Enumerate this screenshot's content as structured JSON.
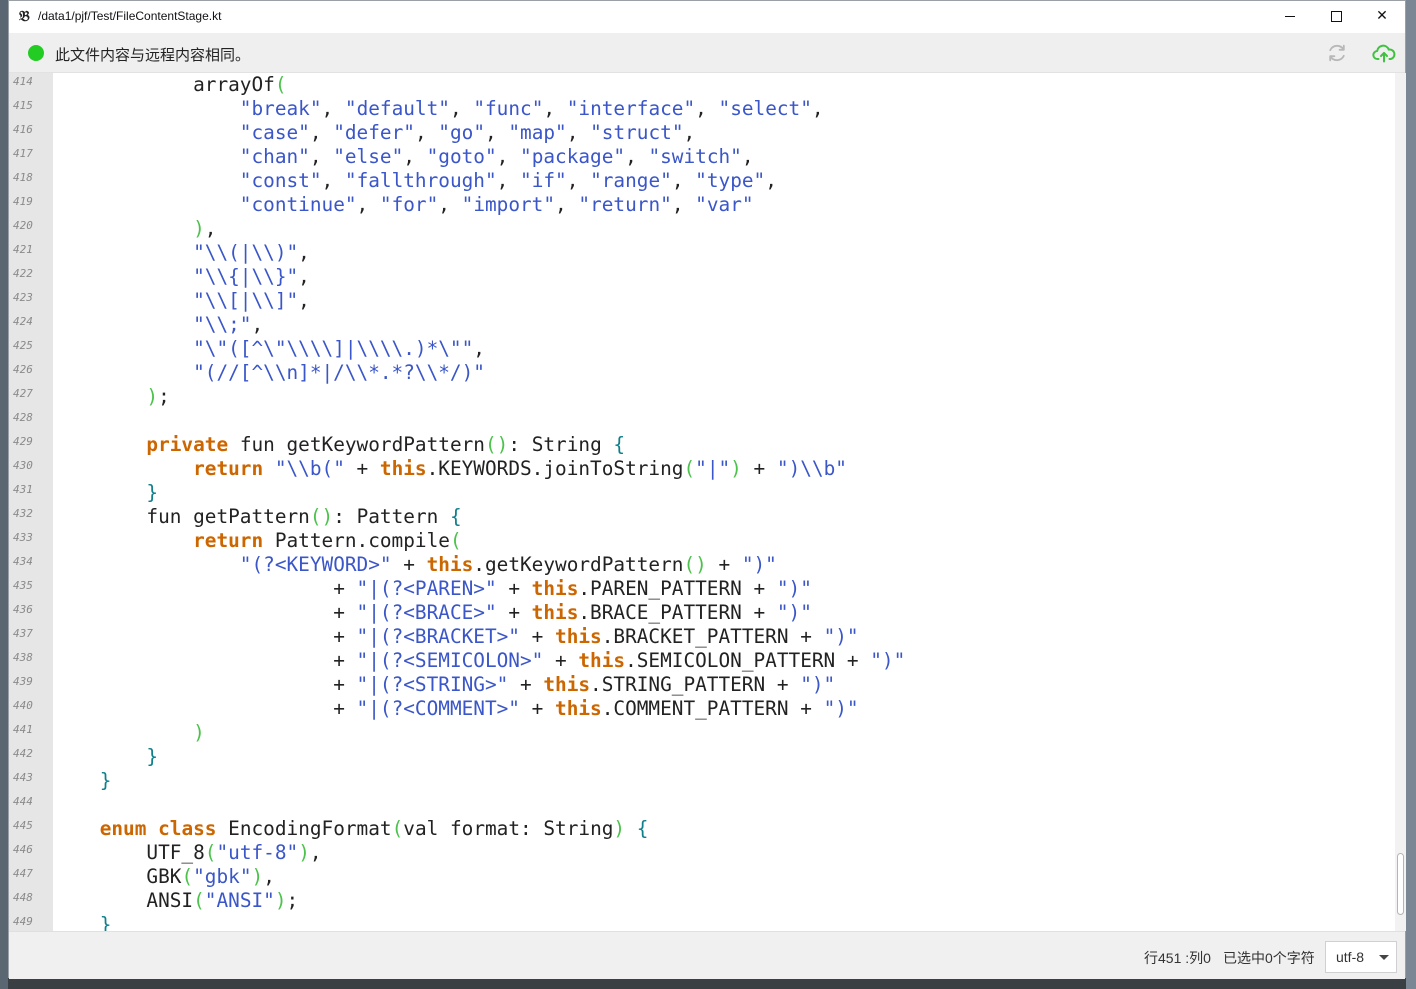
{
  "window": {
    "title": "/data1/pjf/Test/FileContentStage.kt",
    "app_icon": "𝔅",
    "close_glyph": "✕"
  },
  "infobar": {
    "status_color": "#22cc22",
    "message": "此文件内容与远程内容相同。",
    "icons": [
      "refresh-icon",
      "cloud-upload-icon"
    ]
  },
  "editor": {
    "lines": [
      {
        "n": "414",
        "tokens": [
          [
            "            ",
            "plain"
          ],
          [
            "arrayOf",
            "plain"
          ],
          [
            "(",
            "paren"
          ]
        ]
      },
      {
        "n": "415",
        "tokens": [
          [
            "                ",
            "plain"
          ],
          [
            "\"break\"",
            "str"
          ],
          [
            ", ",
            "op"
          ],
          [
            "\"default\"",
            "str"
          ],
          [
            ", ",
            "op"
          ],
          [
            "\"func\"",
            "str"
          ],
          [
            ", ",
            "op"
          ],
          [
            "\"interface\"",
            "str"
          ],
          [
            ", ",
            "op"
          ],
          [
            "\"select\"",
            "str"
          ],
          [
            ",",
            "op"
          ]
        ]
      },
      {
        "n": "416",
        "tokens": [
          [
            "                ",
            "plain"
          ],
          [
            "\"case\"",
            "str"
          ],
          [
            ", ",
            "op"
          ],
          [
            "\"defer\"",
            "str"
          ],
          [
            ", ",
            "op"
          ],
          [
            "\"go\"",
            "str"
          ],
          [
            ", ",
            "op"
          ],
          [
            "\"map\"",
            "str"
          ],
          [
            ", ",
            "op"
          ],
          [
            "\"struct\"",
            "str"
          ],
          [
            ",",
            "op"
          ]
        ]
      },
      {
        "n": "417",
        "tokens": [
          [
            "                ",
            "plain"
          ],
          [
            "\"chan\"",
            "str"
          ],
          [
            ", ",
            "op"
          ],
          [
            "\"else\"",
            "str"
          ],
          [
            ", ",
            "op"
          ],
          [
            "\"goto\"",
            "str"
          ],
          [
            ", ",
            "op"
          ],
          [
            "\"package\"",
            "str"
          ],
          [
            ", ",
            "op"
          ],
          [
            "\"switch\"",
            "str"
          ],
          [
            ",",
            "op"
          ]
        ]
      },
      {
        "n": "418",
        "tokens": [
          [
            "                ",
            "plain"
          ],
          [
            "\"const\"",
            "str"
          ],
          [
            ", ",
            "op"
          ],
          [
            "\"fallthrough\"",
            "str"
          ],
          [
            ", ",
            "op"
          ],
          [
            "\"if\"",
            "str"
          ],
          [
            ", ",
            "op"
          ],
          [
            "\"range\"",
            "str"
          ],
          [
            ", ",
            "op"
          ],
          [
            "\"type\"",
            "str"
          ],
          [
            ",",
            "op"
          ]
        ]
      },
      {
        "n": "419",
        "tokens": [
          [
            "                ",
            "plain"
          ],
          [
            "\"continue\"",
            "str"
          ],
          [
            ", ",
            "op"
          ],
          [
            "\"for\"",
            "str"
          ],
          [
            ", ",
            "op"
          ],
          [
            "\"import\"",
            "str"
          ],
          [
            ", ",
            "op"
          ],
          [
            "\"return\"",
            "str"
          ],
          [
            ", ",
            "op"
          ],
          [
            "\"var\"",
            "str"
          ]
        ]
      },
      {
        "n": "420",
        "tokens": [
          [
            "            ",
            "plain"
          ],
          [
            ")",
            "paren"
          ],
          [
            ",",
            "op"
          ]
        ]
      },
      {
        "n": "421",
        "tokens": [
          [
            "            ",
            "plain"
          ],
          [
            "\"\\\\(|\\\\)\"",
            "str"
          ],
          [
            ",",
            "op"
          ]
        ]
      },
      {
        "n": "422",
        "tokens": [
          [
            "            ",
            "plain"
          ],
          [
            "\"\\\\{|\\\\}\"",
            "str"
          ],
          [
            ",",
            "op"
          ]
        ]
      },
      {
        "n": "423",
        "tokens": [
          [
            "            ",
            "plain"
          ],
          [
            "\"\\\\[|\\\\]\"",
            "str"
          ],
          [
            ",",
            "op"
          ]
        ]
      },
      {
        "n": "424",
        "tokens": [
          [
            "            ",
            "plain"
          ],
          [
            "\"\\\\;\"",
            "str"
          ],
          [
            ",",
            "op"
          ]
        ]
      },
      {
        "n": "425",
        "tokens": [
          [
            "            ",
            "plain"
          ],
          [
            "\"\\\"([^\\\"\\\\\\\\]|\\\\\\\\.)*\\\"\"",
            "str"
          ],
          [
            ",",
            "op"
          ]
        ]
      },
      {
        "n": "426",
        "tokens": [
          [
            "            ",
            "plain"
          ],
          [
            "\"(//[^\\\\n]*|/\\\\*.*?\\\\*/)\"",
            "str"
          ]
        ]
      },
      {
        "n": "427",
        "tokens": [
          [
            "        ",
            "plain"
          ],
          [
            ")",
            "paren"
          ],
          [
            ";",
            "op"
          ]
        ]
      },
      {
        "n": "428",
        "tokens": []
      },
      {
        "n": "429",
        "tokens": [
          [
            "        ",
            "plain"
          ],
          [
            "private",
            "kw"
          ],
          [
            " fun getKeywordPattern",
            "plain"
          ],
          [
            "()",
            "paren"
          ],
          [
            ": String ",
            "plain"
          ],
          [
            "{",
            "brace"
          ]
        ]
      },
      {
        "n": "430",
        "tokens": [
          [
            "            ",
            "plain"
          ],
          [
            "return",
            "kw"
          ],
          [
            " ",
            "plain"
          ],
          [
            "\"\\\\b(\"",
            "str"
          ],
          [
            " + ",
            "op"
          ],
          [
            "this",
            "kw"
          ],
          [
            ".KEYWORDS.joinToString",
            "plain"
          ],
          [
            "(",
            "paren"
          ],
          [
            "\"|\"",
            "str"
          ],
          [
            ")",
            "paren"
          ],
          [
            " + ",
            "op"
          ],
          [
            "\")\\\\b\"",
            "str"
          ]
        ]
      },
      {
        "n": "431",
        "tokens": [
          [
            "        ",
            "plain"
          ],
          [
            "}",
            "brace"
          ]
        ]
      },
      {
        "n": "432",
        "tokens": [
          [
            "        ",
            "plain"
          ],
          [
            "fun getPattern",
            "plain"
          ],
          [
            "()",
            "paren"
          ],
          [
            ": Pattern ",
            "plain"
          ],
          [
            "{",
            "brace"
          ]
        ]
      },
      {
        "n": "433",
        "tokens": [
          [
            "            ",
            "plain"
          ],
          [
            "return",
            "kw"
          ],
          [
            " Pattern.compile",
            "plain"
          ],
          [
            "(",
            "paren"
          ]
        ]
      },
      {
        "n": "434",
        "tokens": [
          [
            "                ",
            "plain"
          ],
          [
            "\"(?<KEYWORD>\"",
            "str"
          ],
          [
            " + ",
            "op"
          ],
          [
            "this",
            "kw"
          ],
          [
            ".getKeywordPattern",
            "plain"
          ],
          [
            "()",
            "paren"
          ],
          [
            " + ",
            "op"
          ],
          [
            "\")\"",
            "str"
          ]
        ]
      },
      {
        "n": "435",
        "tokens": [
          [
            "                        ",
            "plain"
          ],
          [
            "+ ",
            "op"
          ],
          [
            "\"|(?<PAREN>\"",
            "str"
          ],
          [
            " + ",
            "op"
          ],
          [
            "this",
            "kw"
          ],
          [
            ".PAREN_PATTERN",
            "plain"
          ],
          [
            " + ",
            "op"
          ],
          [
            "\")\"",
            "str"
          ]
        ]
      },
      {
        "n": "436",
        "tokens": [
          [
            "                        ",
            "plain"
          ],
          [
            "+ ",
            "op"
          ],
          [
            "\"|(?<BRACE>\"",
            "str"
          ],
          [
            " + ",
            "op"
          ],
          [
            "this",
            "kw"
          ],
          [
            ".BRACE_PATTERN",
            "plain"
          ],
          [
            " + ",
            "op"
          ],
          [
            "\")\"",
            "str"
          ]
        ]
      },
      {
        "n": "437",
        "tokens": [
          [
            "                        ",
            "plain"
          ],
          [
            "+ ",
            "op"
          ],
          [
            "\"|(?<BRACKET>\"",
            "str"
          ],
          [
            " + ",
            "op"
          ],
          [
            "this",
            "kw"
          ],
          [
            ".BRACKET_PATTERN",
            "plain"
          ],
          [
            " + ",
            "op"
          ],
          [
            "\")\"",
            "str"
          ]
        ]
      },
      {
        "n": "438",
        "tokens": [
          [
            "                        ",
            "plain"
          ],
          [
            "+ ",
            "op"
          ],
          [
            "\"|(?<SEMICOLON>\"",
            "str"
          ],
          [
            " + ",
            "op"
          ],
          [
            "this",
            "kw"
          ],
          [
            ".SEMICOLON_PATTERN",
            "plain"
          ],
          [
            " + ",
            "op"
          ],
          [
            "\")\"",
            "str"
          ]
        ]
      },
      {
        "n": "439",
        "tokens": [
          [
            "                        ",
            "plain"
          ],
          [
            "+ ",
            "op"
          ],
          [
            "\"|(?<STRING>\"",
            "str"
          ],
          [
            " + ",
            "op"
          ],
          [
            "this",
            "kw"
          ],
          [
            ".STRING_PATTERN",
            "plain"
          ],
          [
            " + ",
            "op"
          ],
          [
            "\")\"",
            "str"
          ]
        ]
      },
      {
        "n": "440",
        "tokens": [
          [
            "                        ",
            "plain"
          ],
          [
            "+ ",
            "op"
          ],
          [
            "\"|(?<COMMENT>\"",
            "str"
          ],
          [
            " + ",
            "op"
          ],
          [
            "this",
            "kw"
          ],
          [
            ".COMMENT_PATTERN",
            "plain"
          ],
          [
            " + ",
            "op"
          ],
          [
            "\")\"",
            "str"
          ]
        ]
      },
      {
        "n": "441",
        "tokens": [
          [
            "            ",
            "plain"
          ],
          [
            ")",
            "paren"
          ]
        ]
      },
      {
        "n": "442",
        "tokens": [
          [
            "        ",
            "plain"
          ],
          [
            "}",
            "brace"
          ]
        ]
      },
      {
        "n": "443",
        "tokens": [
          [
            "    ",
            "plain"
          ],
          [
            "}",
            "brace"
          ]
        ]
      },
      {
        "n": "444",
        "tokens": []
      },
      {
        "n": "445",
        "tokens": [
          [
            "    ",
            "plain"
          ],
          [
            "enum",
            "kw"
          ],
          [
            " ",
            "plain"
          ],
          [
            "class",
            "kw"
          ],
          [
            " EncodingFormat",
            "plain"
          ],
          [
            "(",
            "paren"
          ],
          [
            "val format: String",
            "plain"
          ],
          [
            ")",
            "paren"
          ],
          [
            " ",
            "plain"
          ],
          [
            "{",
            "brace"
          ]
        ]
      },
      {
        "n": "446",
        "tokens": [
          [
            "        ",
            "plain"
          ],
          [
            "UTF_8",
            "plain"
          ],
          [
            "(",
            "paren"
          ],
          [
            "\"utf-8\"",
            "str"
          ],
          [
            ")",
            "paren"
          ],
          [
            ",",
            "op"
          ]
        ]
      },
      {
        "n": "447",
        "tokens": [
          [
            "        ",
            "plain"
          ],
          [
            "GBK",
            "plain"
          ],
          [
            "(",
            "paren"
          ],
          [
            "\"gbk\"",
            "str"
          ],
          [
            ")",
            "paren"
          ],
          [
            ",",
            "op"
          ]
        ]
      },
      {
        "n": "448",
        "tokens": [
          [
            "        ",
            "plain"
          ],
          [
            "ANSI",
            "plain"
          ],
          [
            "(",
            "paren"
          ],
          [
            "\"ANSI\"",
            "str"
          ],
          [
            ")",
            "paren"
          ],
          [
            ";",
            "op"
          ]
        ]
      },
      {
        "n": "449",
        "tokens": [
          [
            "    ",
            "plain"
          ],
          [
            "}",
            "brace"
          ]
        ]
      }
    ]
  },
  "statusbar": {
    "cursor_position": "行451 :列0",
    "selection": "已选中0个字符",
    "encoding": "utf-8"
  }
}
